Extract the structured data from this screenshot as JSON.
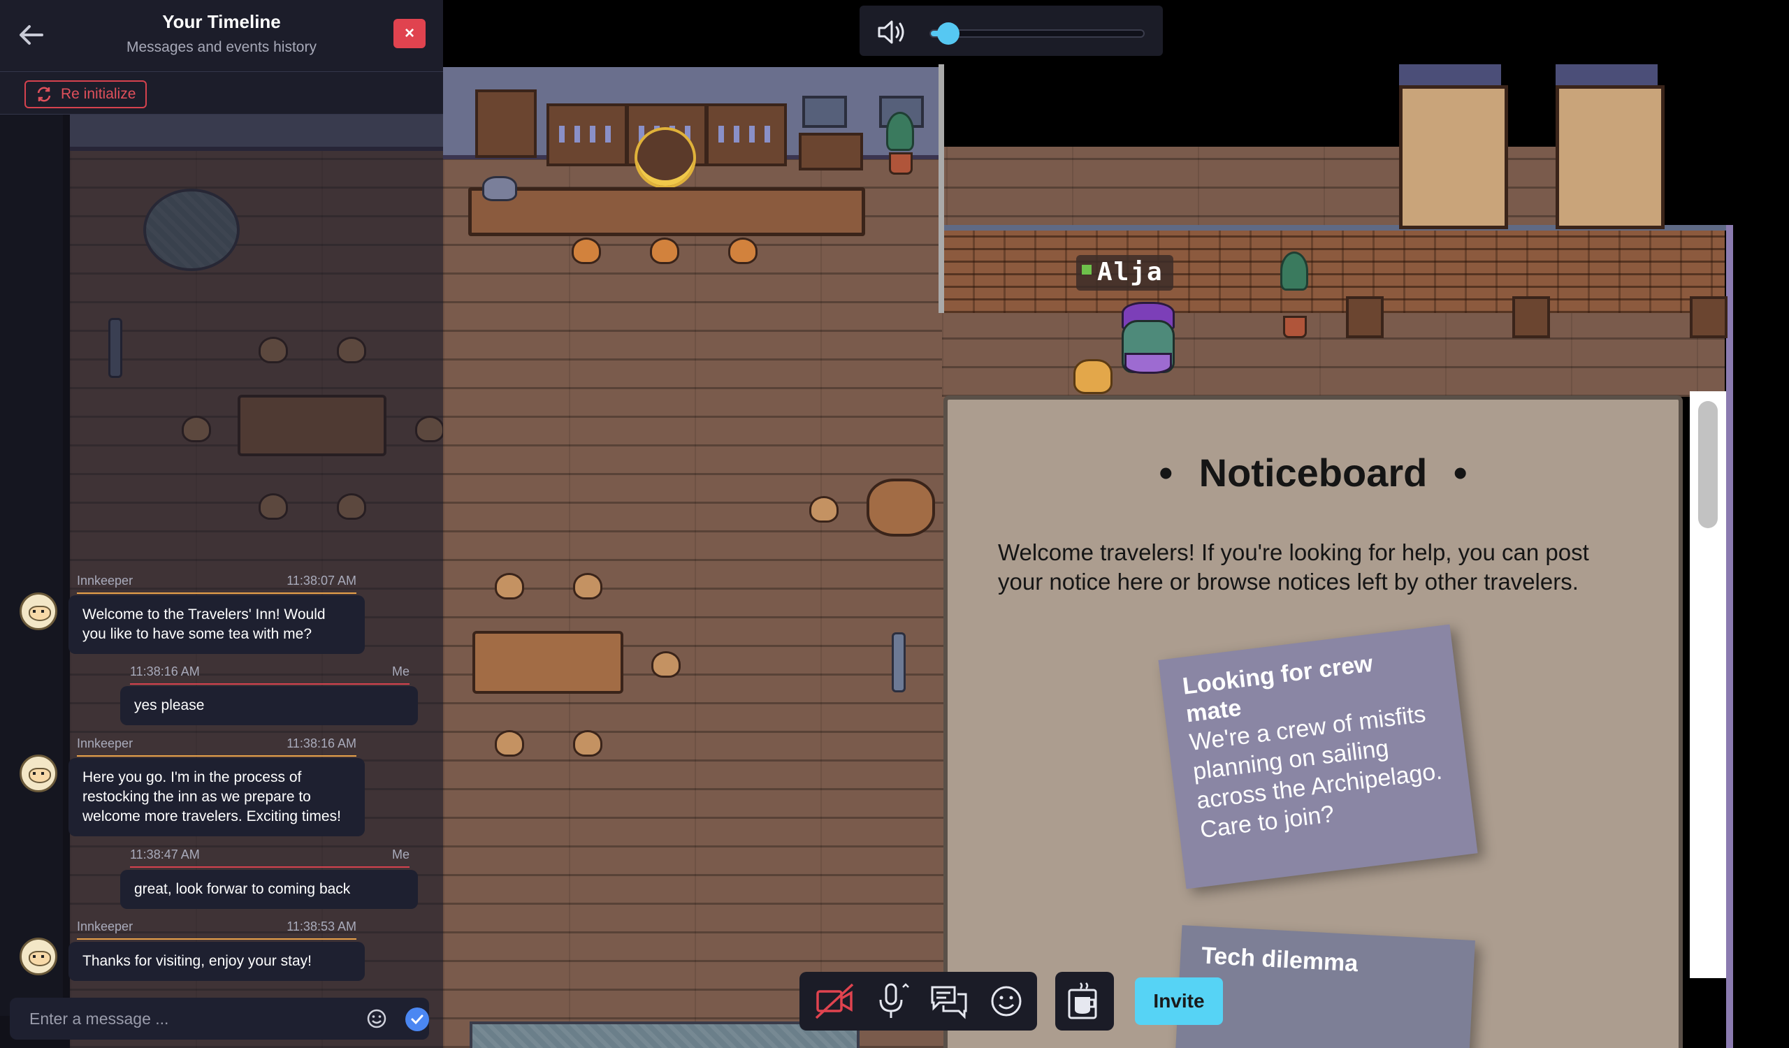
{
  "timeline": {
    "title": "Your Timeline",
    "subtitle": "Messages and events history",
    "close_label": "×",
    "reinit_label": "Re initialize"
  },
  "messages": [
    {
      "sender": "Innkeeper",
      "time": "11:38:07 AM",
      "text": "Welcome to the Travelers' Inn! Would you like to have some tea with me?"
    },
    {
      "sender": "Me",
      "time": "11:38:16 AM",
      "text": "yes please"
    },
    {
      "sender": "Innkeeper",
      "time": "11:38:16 AM",
      "text": "Here you go. I'm in the process of restocking the inn as we prepare to welcome more travelers. Exciting times!"
    },
    {
      "sender": "Me",
      "time": "11:38:47 AM",
      "text": "great, look forwar to coming back"
    },
    {
      "sender": "Innkeeper",
      "time": "11:38:53 AM",
      "text": "Thanks for visiting, enjoy your stay!"
    }
  ],
  "message_input": {
    "placeholder": "Enter a message ..."
  },
  "volume": {
    "level": 0.05
  },
  "player": {
    "name": "Alja"
  },
  "noticeboard": {
    "title": "Noticeboard",
    "bullet": "•",
    "intro": "Welcome travelers! If you're looking for help, you can post your notice here or browse notices left by other travelers.",
    "notes": [
      {
        "title": "Looking for crew mate",
        "body": "We're a crew of misfits planning on sailing across the Archipelago. Care to join?"
      },
      {
        "title": "Tech dilemma",
        "body": ""
      }
    ]
  },
  "actions": {
    "invite_label": "Invite"
  },
  "colors": {
    "accent": "#56c8f2",
    "danger": "#e0434f",
    "panel": "#1c1d2a",
    "innkeeper_line": "#e9a24a",
    "me_line": "#d6424e"
  }
}
